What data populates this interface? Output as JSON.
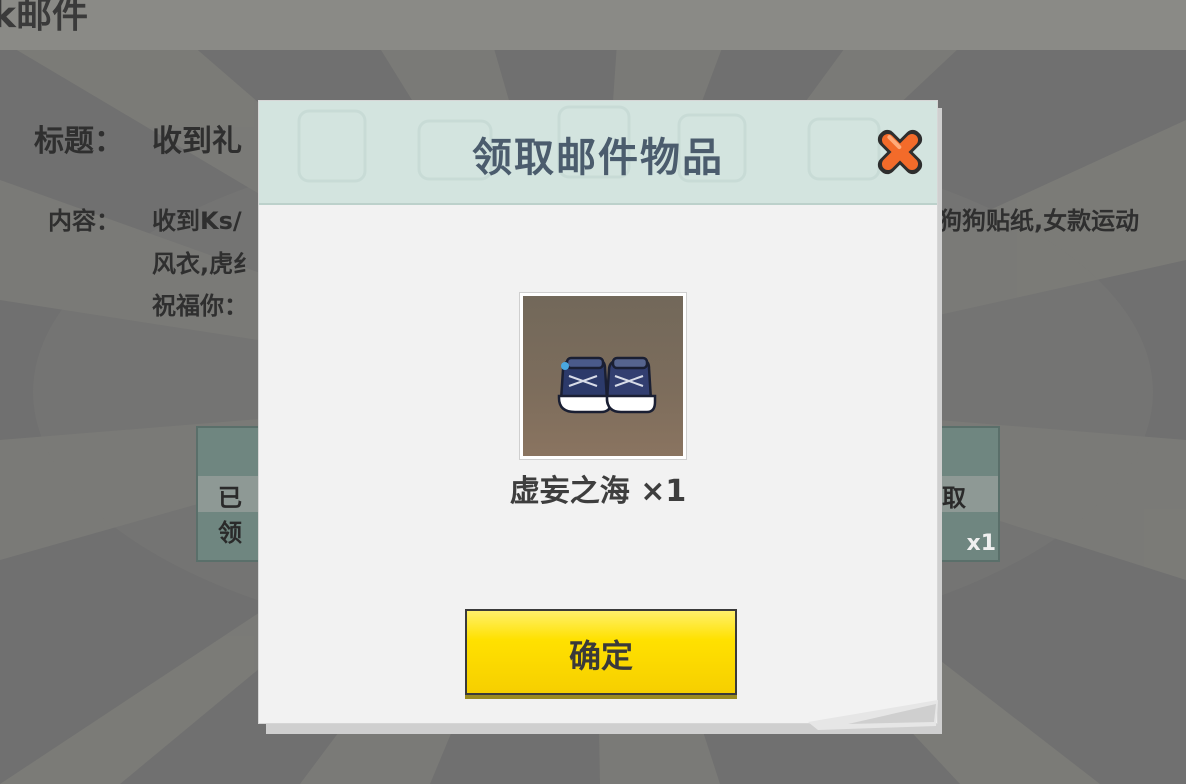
{
  "background": {
    "header_title": "k邮件",
    "mail": {
      "title_label": "标题：",
      "title_value": "收到礼",
      "content_label": "内容：",
      "content_line1": "收到Ks/",
      "content_line1_right": "狗狗贴纸,女款运动",
      "content_line2": "风衣,虎纟",
      "content_line3": "祝福你："
    },
    "left_card": {
      "label": "已领"
    },
    "right_card": {
      "label": "取",
      "count": "x1"
    }
  },
  "dialog": {
    "title": "领取邮件物品",
    "item_name": "虚妄之海 ×1",
    "item_icon": "sneakers-icon",
    "confirm_label": "确定",
    "colors": {
      "header_bg": "#d3e4df",
      "title_text": "#4b5c6d",
      "close_orange": "#f36b2a",
      "confirm_yellow": "#ffe100"
    }
  }
}
